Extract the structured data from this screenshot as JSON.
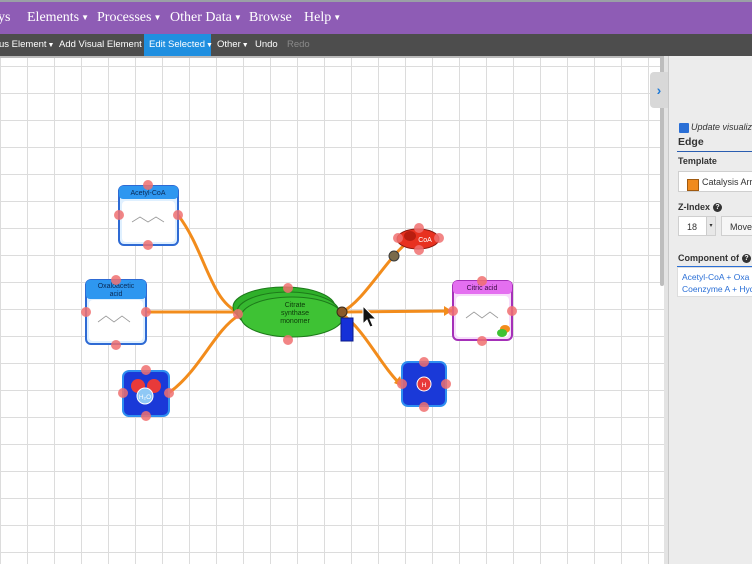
{
  "menu": {
    "items": [
      "ys",
      "Elements",
      "Processes",
      "Other Data",
      "Browse",
      "Help"
    ]
  },
  "toolbar": {
    "items": [
      "us Element",
      "Add Visual Element",
      "Edit Selected",
      "Other",
      "Undo",
      "Redo"
    ]
  },
  "diagram": {
    "nodes": {
      "acetyl_coa": "Acetyl-CoA",
      "oxaloacetic": [
        "Oxaloacetic",
        "acid"
      ],
      "citrate_synthase": [
        "Citrate",
        "synthase",
        "monomer"
      ],
      "coa": "CoA",
      "citric_acid": "Citric acid",
      "h2o": "H₂O",
      "h": "H"
    }
  },
  "panel": {
    "update_label": "Update visualiza",
    "section_title": "Edge",
    "template_label": "Template",
    "template_value": "Catalysis Arro",
    "zindex_label": "Z-Index",
    "zindex_value": "18",
    "move_label": "Move",
    "component_label": "Component of",
    "component_line1": "Acetyl-CoA  +  Oxa",
    "component_line2": "Coenzyme A  +  Hyd"
  },
  "colors": {
    "menubar": "#8e5cb5",
    "toolbar": "#4d4d4d",
    "active_tab": "#1f8fe0",
    "edge": "#f28c1c",
    "enzyme": "#3ec234",
    "metabolite_header": "#2e97f0",
    "citric_header": "#e46ff0",
    "handle": "#f07070"
  }
}
